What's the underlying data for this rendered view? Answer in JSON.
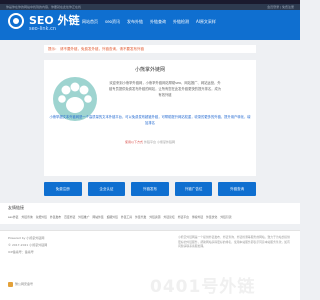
{
  "topbar": {
    "left": "你是你在你的网站中找到的内容，你要就在此处你正在找",
    "right": "会员登录 | 免费注册"
  },
  "header": {
    "logo_title": "SEO 外链",
    "logo_sub": "seo-link.cn",
    "nav": [
      "网站首页",
      "seo资讯",
      "发布外链",
      "外链查询",
      "外链检测",
      "AI原文采样"
    ]
  },
  "notice": {
    "label": "提示：",
    "text": "请不要外链，免费发外链，外链查询，请不要发布外链"
  },
  "main": {
    "title": "小熊掌外链网",
    "desc": "欢迎来到小熊掌外链网，小熊掌外链网站帮助seo、网站推广、网站运营，外链专员提供免费发布外链的网站，让所有您在此发外链更快的提升排名，成为有效外链",
    "desc2": "小熊掌超文本外链网是一个高质量的文本外链平台，可以免费发布超链外链，可帮助提升网站权重，收录的更多的外链，提升用户转化，增加排名",
    "small1": "使用以下方式",
    "small2": "外链平台 小熊掌外链网"
  },
  "buttons": [
    "免费注册",
    "企业认证",
    "外链发布",
    "外链广告位",
    "外链查询"
  ],
  "links": {
    "title": "友情链接",
    "items": [
      "seo外链",
      "外链查询",
      "免费外链",
      "外链发布",
      "百度外链",
      "外链推广",
      "网站外链",
      "超级外链",
      "外链工具",
      "外链代发",
      "外链资源",
      "外链论坛",
      "外链平台",
      "博客外链",
      "外链优化",
      "外链引流"
    ]
  },
  "footer": {
    "lines": [
      "Powered by 小熊掌外链网",
      "© 2017-2021 小熊掌外链网",
      "ICP备案号：备案号"
    ],
    "right": "小熊掌外链网是一个提供外链发布、外链查询、外链检测等服务的网站，致力于为站长提供更好的外链服务，帮助网站获得更好的排名，使用本站服务即表示同意本站服务条款，如有问题请联系客服处理。",
    "watermark": "0401号外链",
    "icp": "豫公网安备号"
  }
}
